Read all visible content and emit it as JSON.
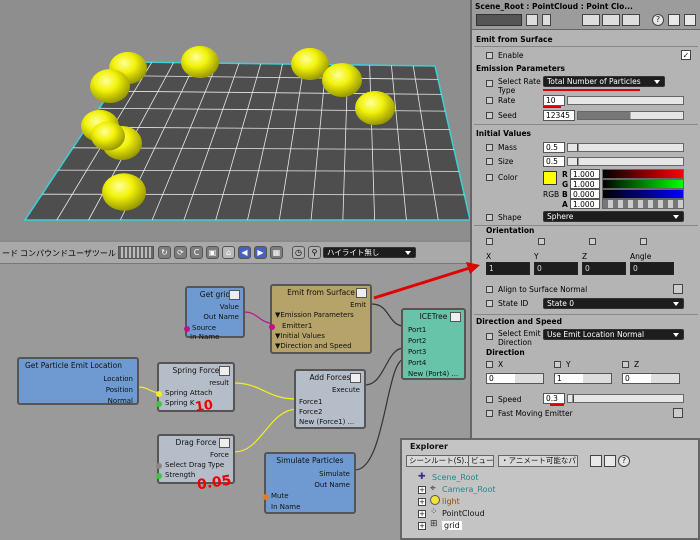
{
  "ice_toolbar": {
    "items": [
      "ード",
      "コンパウンド",
      "ユーザツール"
    ],
    "highlight_mode": "ハイライト無し"
  },
  "nodes": {
    "get_grid": {
      "title": "Get grid",
      "value": "Value",
      "out_name": "Out Name",
      "source": "Source",
      "in_name": "In Name"
    },
    "emit_from_surface": {
      "title": "Emit from Surface",
      "emit": "Emit",
      "emission_params": "▼Emission Parameters",
      "emitter1": "Emitter1",
      "initial_values": "▼Initial Values",
      "direction_speed": "▼Direction and Speed"
    },
    "ice_tree": {
      "title": "ICETree",
      "ports": [
        "Port1",
        "Port2",
        "Port3",
        "Port4",
        "New (Port4) ..."
      ]
    },
    "get_particle_emit_location": {
      "title": "Get Particle Emit Location",
      "location": "Location",
      "position": "Position",
      "normal": "Normal"
    },
    "spring_force": {
      "title": "Spring Force",
      "result": "result",
      "spring_attach": "Spring Attach",
      "spring_k": "Spring K"
    },
    "add_forces": {
      "title": "Add Forces",
      "execute": "Execute",
      "force1": "Force1",
      "force2": "Force2",
      "new_force": "New (Force1) ..."
    },
    "drag_force": {
      "title": "Drag Force",
      "force": "Force",
      "select_drag_type": "Select Drag Type",
      "strength": "Strength"
    },
    "simulate_particles": {
      "title": "Simulate Particles",
      "simulate": "Simulate",
      "out_name": "Out Name",
      "mute": "Mute",
      "in_name": "In Name"
    }
  },
  "annotations": {
    "spring_k_value": "10",
    "strength_value": "0.05"
  },
  "panel": {
    "title": "Scene_Root : PointCloud : Point Clo...",
    "emit_header": "Emit from Surface",
    "enable_label": "Enable",
    "emission_params_header": "Emission Parameters",
    "select_rate_type_label": "Select Rate",
    "select_rate_type_label2": "Type",
    "select_rate_type_value": "Total Number of Particles",
    "rate_label": "Rate",
    "rate_value": "10",
    "seed_label": "Seed",
    "seed_value": "12345",
    "initial_values_header": "Initial Values",
    "mass_label": "Mass",
    "mass_value": "0.5",
    "size_label": "Size",
    "size_value": "0.5",
    "color_label": "Color",
    "rgb_label": "RGB",
    "color_channels": [
      {
        "ch": "R",
        "value": "1.000"
      },
      {
        "ch": "G",
        "value": "1.000"
      },
      {
        "ch": "B",
        "value": "0.000"
      },
      {
        "ch": "A",
        "value": "1.000"
      }
    ],
    "swatch_color": "#ffff00",
    "shape_label": "Shape",
    "shape_value": "Sphere",
    "orientation_header": "Orientation",
    "orientation_cols": [
      "X",
      "Y",
      "Z",
      "Angle"
    ],
    "orientation_values": [
      "1",
      "0",
      "0",
      "0"
    ],
    "align_label": "Align to Surface Normal",
    "state_id_label": "State ID",
    "state_id_value": "State 0",
    "direction_speed_header": "Direction and Speed",
    "select_emit_label": "Select Emit",
    "select_emit_label2": "Direction",
    "select_emit_value": "Use Emit Location Normal",
    "direction_header": "Direction",
    "direction_cols": [
      "X",
      "Y",
      "Z"
    ],
    "direction_values": [
      "0",
      "1",
      "0"
    ],
    "speed_label": "Speed",
    "speed_value": "0.3",
    "fast_moving_label": "Fast Moving Emitter"
  },
  "explorer": {
    "title": "Explorer",
    "toolbar": [
      "シーンルート(S)...",
      "ビュー・",
      "・アニメート可能なパラ・"
    ],
    "tree": [
      "Scene_Root",
      "Camera_Root",
      "light",
      "PointCloud",
      "grid"
    ]
  },
  "colors": {
    "accent_red": "#e00000",
    "sphere_yellow": "#f2f20a",
    "grid_cyan": "#3ad1d6"
  }
}
